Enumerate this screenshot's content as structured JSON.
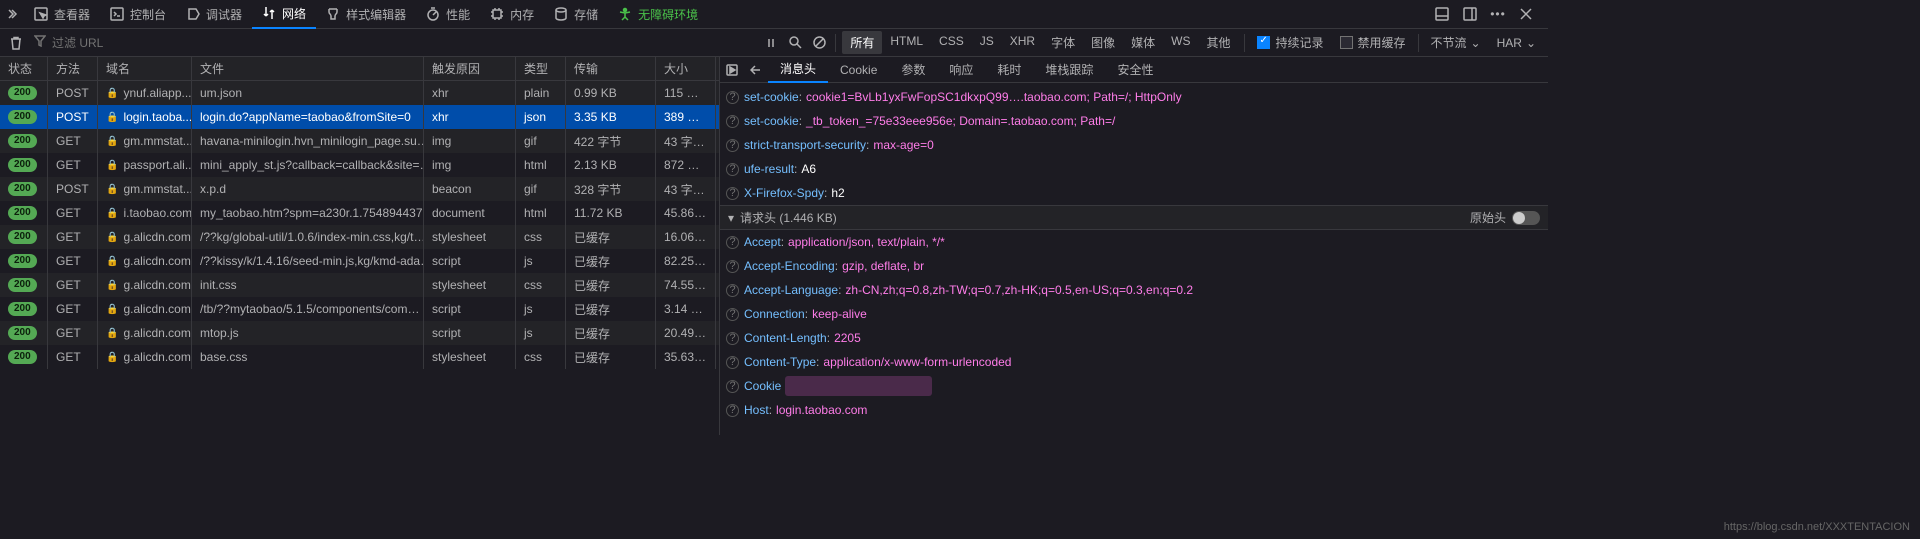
{
  "toolbar": {
    "tabs": [
      {
        "id": "inspector",
        "label": "查看器"
      },
      {
        "id": "console",
        "label": "控制台"
      },
      {
        "id": "debugger",
        "label": "调试器"
      },
      {
        "id": "network",
        "label": "网络",
        "active": true
      },
      {
        "id": "style",
        "label": "样式编辑器"
      },
      {
        "id": "performance",
        "label": "性能"
      },
      {
        "id": "memory",
        "label": "内存"
      },
      {
        "id": "storage",
        "label": "存储"
      },
      {
        "id": "accessibility",
        "label": "无障碍环境",
        "a11y": true
      }
    ],
    "more_icon": "more",
    "dock_side_icon": "dock-side",
    "dock_bottom_icon": "dock-bottom",
    "close_icon": "close"
  },
  "filter": {
    "trash_icon": "trash",
    "filter_icon": "filter",
    "url_placeholder": "过滤 URL",
    "pause_icon": "pause",
    "search_icon": "search",
    "block_icon": "block",
    "types": [
      {
        "label": "所有",
        "active": true
      },
      {
        "label": "HTML"
      },
      {
        "label": "CSS"
      },
      {
        "label": "JS"
      },
      {
        "label": "XHR"
      },
      {
        "label": "字体"
      },
      {
        "label": "图像"
      },
      {
        "label": "媒体"
      },
      {
        "label": "WS"
      },
      {
        "label": "其他"
      }
    ],
    "persist": {
      "label": "持续记录",
      "checked": true
    },
    "disable_cache": {
      "label": "禁用缓存",
      "checked": false
    },
    "throttle": "不节流",
    "har": "HAR"
  },
  "columns": {
    "status": "状态",
    "method": "方法",
    "domain": "域名",
    "file": "文件",
    "cause": "触发原因",
    "type": "类型",
    "transferred": "传输",
    "size": "大小"
  },
  "requests": [
    {
      "status": "200",
      "method": "POST",
      "domain": "ynuf.aliapp...",
      "file": "um.json",
      "cause": "xhr",
      "type": "plain",
      "trans": "0.99 KB",
      "size": "115 …"
    },
    {
      "status": "200",
      "method": "POST",
      "domain": "login.taoba...",
      "file": "login.do?appName=taobao&fromSite=0",
      "cause": "xhr",
      "type": "json",
      "trans": "3.35 KB",
      "size": "389 …",
      "selected": true
    },
    {
      "status": "200",
      "method": "GET",
      "domain": "gm.mmstat...",
      "file": "havana-minilogin.hvn_minilogin_page.su…",
      "cause": "img",
      "type": "gif",
      "trans": "422 字节",
      "size": "43 字…"
    },
    {
      "status": "200",
      "method": "GET",
      "domain": "passport.ali...",
      "file": "mini_apply_st.js?callback=callback&site=…",
      "cause": "img",
      "type": "html",
      "trans": "2.13 KB",
      "size": "872 …"
    },
    {
      "status": "200",
      "method": "POST",
      "domain": "gm.mmstat...",
      "file": "x.p.d",
      "cause": "beacon",
      "type": "gif",
      "trans": "328 字节",
      "size": "43 字…"
    },
    {
      "status": "200",
      "method": "GET",
      "domain": "i.taobao.com",
      "file": "my_taobao.htm?spm=a230r.1.754894437…",
      "cause": "document",
      "type": "html",
      "trans": "11.72 KB",
      "size": "45.86…"
    },
    {
      "status": "200",
      "method": "GET",
      "domain": "g.alicdn.com",
      "file": "/??kg/global-util/1.0.6/index-min.css,kg/t…",
      "cause": "stylesheet",
      "type": "css",
      "trans": "已缓存",
      "size": "16.06…"
    },
    {
      "status": "200",
      "method": "GET",
      "domain": "g.alicdn.com",
      "file": "/??kissy/k/1.4.16/seed-min.js,kg/kmd-ada…",
      "cause": "script",
      "type": "js",
      "trans": "已缓存",
      "size": "82.25…"
    },
    {
      "status": "200",
      "method": "GET",
      "domain": "g.alicdn.com",
      "file": "init.css",
      "cause": "stylesheet",
      "type": "css",
      "trans": "已缓存",
      "size": "74.55…"
    },
    {
      "status": "200",
      "method": "GET",
      "domain": "g.alicdn.com",
      "file": "/tb/??mytaobao/5.1.5/components/com…",
      "cause": "script",
      "type": "js",
      "trans": "已缓存",
      "size": "3.14 …"
    },
    {
      "status": "200",
      "method": "GET",
      "domain": "g.alicdn.com",
      "file": "mtop.js",
      "cause": "script",
      "type": "js",
      "trans": "已缓存",
      "size": "20.49…"
    },
    {
      "status": "200",
      "method": "GET",
      "domain": "g.alicdn.com",
      "file": "base.css",
      "cause": "stylesheet",
      "type": "css",
      "trans": "已缓存",
      "size": "35.63…"
    }
  ],
  "details": {
    "tabs": [
      {
        "label": "消息头",
        "active": true
      },
      {
        "label": "Cookie"
      },
      {
        "label": "参数"
      },
      {
        "label": "响应"
      },
      {
        "label": "耗时"
      },
      {
        "label": "堆栈跟踪"
      },
      {
        "label": "安全性"
      }
    ],
    "response_headers": [
      {
        "k": "set-cookie",
        "v": "cookie1=BvLb1yxFwFopSC1dkxpQ99….taobao.com; Path=/; HttpOnly",
        "pink": true,
        "q": true
      },
      {
        "k": "set-cookie",
        "v": "_tb_token_=75e33eee956e; Domain=.taobao.com; Path=/",
        "pink": true,
        "q": true
      },
      {
        "k": "strict-transport-security",
        "v": "max-age=0",
        "pink": true,
        "q": true
      },
      {
        "k": "ufe-result",
        "v": "A6"
      },
      {
        "k": "X-Firefox-Spdy",
        "v": "h2"
      }
    ],
    "request_section": {
      "title": "请求头 (1.446 KB)",
      "raw_label": "原始头"
    },
    "request_headers": [
      {
        "k": "Accept",
        "v": "application/json, text/plain, */*",
        "pink": true
      },
      {
        "k": "Accept-Encoding",
        "v": "gzip, deflate, br",
        "pink": true
      },
      {
        "k": "Accept-Language",
        "v": "zh-CN,zh;q=0.8,zh-TW;q=0.7,zh-HK;q=0.5,en-US;q=0.3,en;q=0.2",
        "pink": true
      },
      {
        "k": "Connection",
        "v": "keep-alive",
        "pink": true
      },
      {
        "k": "Content-Length",
        "v": "2205",
        "pink": true
      },
      {
        "k": "Content-Type",
        "v": "application/x-www-form-urlencoded",
        "pink": true
      },
      {
        "k": "Cookie",
        "v": "",
        "dim": true
      },
      {
        "k": "Host",
        "v": "login.taobao.com",
        "pink": true
      }
    ]
  },
  "watermark": "https://blog.csdn.net/XXXTENTACION"
}
